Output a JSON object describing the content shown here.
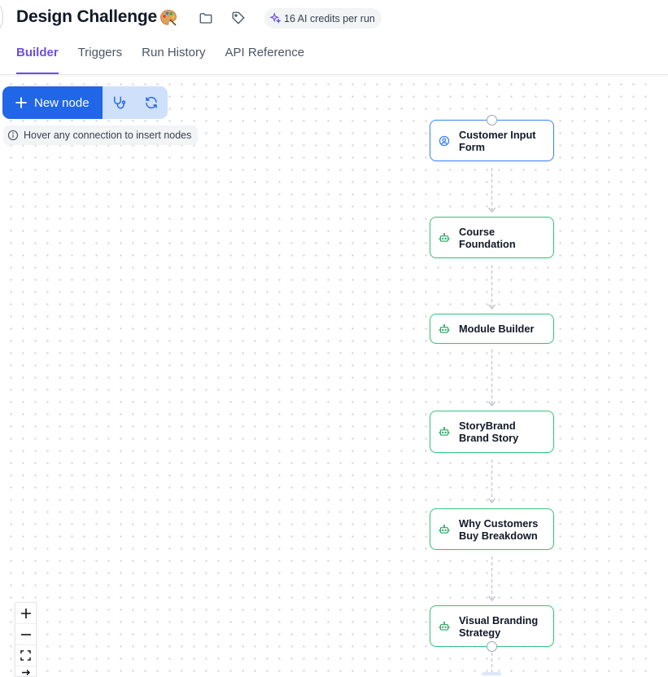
{
  "header": {
    "title": "Design Challenge",
    "title_emoji_icon": "artist-palette-icon",
    "credits_label": "16 AI credits per run",
    "tabs": [
      {
        "label": "Builder",
        "active": true
      },
      {
        "label": "Triggers",
        "active": false
      },
      {
        "label": "Run History",
        "active": false
      },
      {
        "label": "API Reference",
        "active": false
      }
    ]
  },
  "toolbar": {
    "new_node_label": "New node",
    "hint": "Hover any connection to insert nodes"
  },
  "workflow": {
    "nodes": [
      {
        "label_lines": [
          "Customer Input",
          "Form"
        ],
        "type": "input",
        "icon": "user-circle-icon"
      },
      {
        "label_lines": [
          "Course",
          "Foundation"
        ],
        "type": "ai",
        "icon": "robot-icon"
      },
      {
        "label_lines": [
          "Module Builder"
        ],
        "type": "ai",
        "icon": "robot-icon"
      },
      {
        "label_lines": [
          "StoryBrand",
          "Brand Story"
        ],
        "type": "ai",
        "icon": "robot-icon"
      },
      {
        "label_lines": [
          "Why Customers",
          "Buy Breakdown"
        ],
        "type": "ai",
        "icon": "robot-icon"
      },
      {
        "label_lines": [
          "Visual Branding",
          "Strategy"
        ],
        "type": "ai",
        "icon": "robot-icon"
      }
    ]
  },
  "colors": {
    "accent": "#6d4fe0",
    "primary_button": "#2166e6",
    "ai_node_border": "#34c47a",
    "input_node_border": "#3b82f6"
  }
}
